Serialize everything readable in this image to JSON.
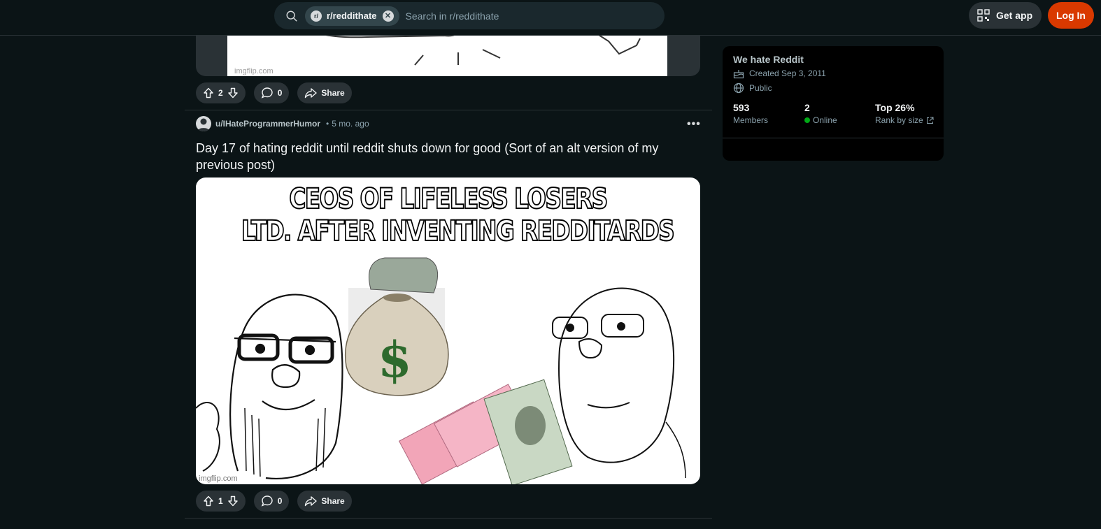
{
  "header": {
    "search_chip": "r/reddithate",
    "search_placeholder": "Search in r/reddithate",
    "get_app": "Get app",
    "login": "Log In"
  },
  "previous_post": {
    "watermark": "imgflip.com",
    "score": "2",
    "comments": "0",
    "share": "Share"
  },
  "post": {
    "author": "u/IHateProgrammerHumor",
    "separator": "•",
    "age": "5 mo. ago",
    "title": "Day 17 of hating reddit until reddit shuts down for good (Sort of an alt version of my previous post)",
    "meme_caption_line1": "CEOS OF LIFELESS LOSERS",
    "meme_caption_line2": "LTD. AFTER INVENTING REDDITARDS",
    "watermark": "imgflip.com",
    "score": "1",
    "comments": "0",
    "share": "Share"
  },
  "sidebar": {
    "title": "We hate Reddit",
    "created": "Created Sep 3, 2011",
    "visibility": "Public",
    "members_value": "593",
    "members_label": "Members",
    "online_value": "2",
    "online_label": "Online",
    "rank_value": "Top 26%",
    "rank_label": "Rank by size"
  },
  "colors": {
    "background": "#0b1416",
    "login_button": "#d93900",
    "online_dot": "#01a816"
  }
}
